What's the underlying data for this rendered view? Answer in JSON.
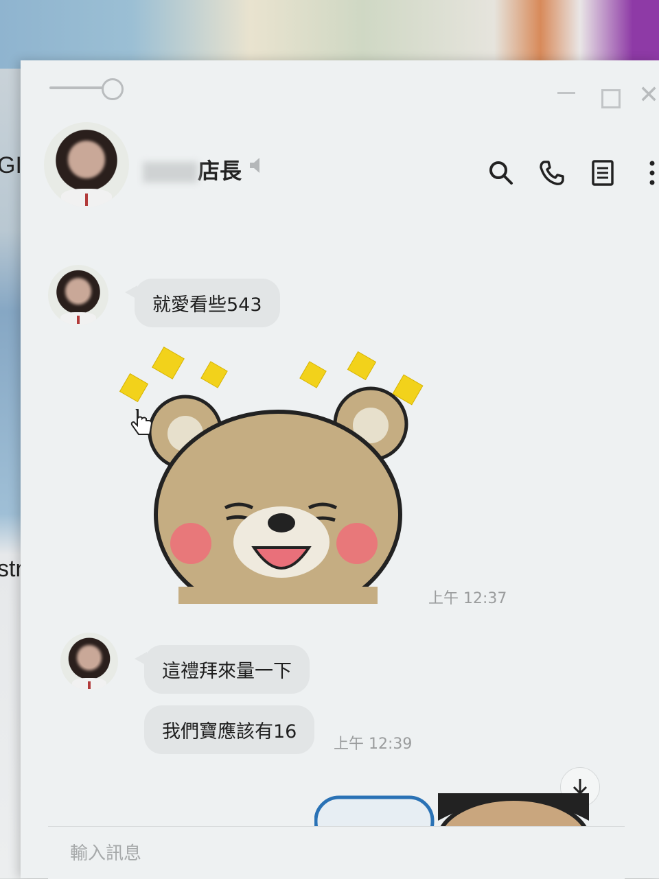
{
  "background": {
    "left_text_top": "GIS",
    "left_text_bottom": "strat"
  },
  "window": {
    "controls": [
      "minimize",
      "maximize",
      "close"
    ]
  },
  "header": {
    "contact_name": "店長",
    "icons": [
      "search-icon",
      "phone-icon",
      "notes-icon",
      "more-icon",
      "mute-icon"
    ]
  },
  "messages": [
    {
      "text": "就愛看些543"
    },
    {
      "type": "sticker",
      "description": "bear"
    },
    {
      "time": "上午 12:37"
    },
    {
      "text": "這禮拜來量一下"
    },
    {
      "text": "我們寶應該有16"
    },
    {
      "time": "上午 12:39"
    }
  ],
  "composer": {
    "placeholder": "輸入訊息"
  },
  "colors": {
    "bubble": "#e2e5e6",
    "window": "#eef1f2",
    "timestamp": "#9a9c9d"
  }
}
